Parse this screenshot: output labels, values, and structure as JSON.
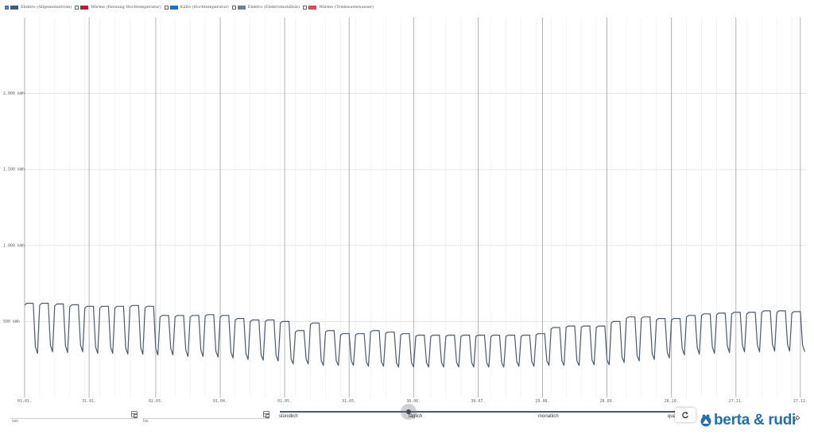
{
  "legend": [
    {
      "label": "Elektro (Allgemeinstrom)",
      "checked": true,
      "color": "#3d5a80"
    },
    {
      "label": "Wärme (Heizung Hochtemperatur)",
      "checked": false,
      "color": "#c0183a"
    },
    {
      "label": "Kälte (Hochtemperatur)",
      "checked": false,
      "color": "#1c73c4"
    },
    {
      "label": "Elektro (Elektromobilität)",
      "checked": false,
      "color": "#6a82a8"
    },
    {
      "label": "Wärme (Trinkwarmwasser)",
      "checked": false,
      "color": "#e0455f"
    }
  ],
  "controls": {
    "from_placeholder": "von",
    "to_placeholder": "bis",
    "resolution_options": [
      "stündlich",
      "täglich",
      "monatlich",
      "quartalsweise"
    ],
    "resolution_visible": [
      "stündlich",
      "täglich",
      "monatlich",
      "quar"
    ],
    "selected_resolution": "täglich"
  },
  "logo": {
    "text": "berta & rudi"
  },
  "chart_data": {
    "type": "line",
    "series": [
      {
        "name": "Elektro (Allgemeinstrom)",
        "color": "#4a5a70"
      }
    ],
    "ylabel_unit": "kWh",
    "yticks": [
      {
        "value": 500,
        "label": "500 kWh"
      },
      {
        "value": 1000,
        "label": "1.000 kWh"
      },
      {
        "value": 1500,
        "label": "1.500 kWh"
      },
      {
        "value": 2000,
        "label": "2.000 kWh"
      }
    ],
    "ylim": [
      0,
      2500
    ],
    "xlim_days": [
      0,
      364
    ],
    "xticks": [
      {
        "day": 0,
        "label": "01.01."
      },
      {
        "day": 30,
        "label": "31.01."
      },
      {
        "day": 61,
        "label": "02.03."
      },
      {
        "day": 91,
        "label": "01.04."
      },
      {
        "day": 121,
        "label": "01.05."
      },
      {
        "day": 151,
        "label": "31.05."
      },
      {
        "day": 181,
        "label": "30.06."
      },
      {
        "day": 211,
        "label": "30.07."
      },
      {
        "day": 241,
        "label": "29.08."
      },
      {
        "day": 271,
        "label": "28.09."
      },
      {
        "day": 301,
        "label": "28.10."
      },
      {
        "day": 331,
        "label": "27.11."
      },
      {
        "day": 361,
        "label": "27.12."
      }
    ],
    "weeks": [
      {
        "start_day": 0,
        "weekday": 620,
        "weekend": 290
      },
      {
        "start_day": 7,
        "weekday": 620,
        "weekend": 300
      },
      {
        "start_day": 14,
        "weekday": 615,
        "weekend": 295
      },
      {
        "start_day": 21,
        "weekday": 610,
        "weekend": 300
      },
      {
        "start_day": 28,
        "weekday": 600,
        "weekend": 290
      },
      {
        "start_day": 35,
        "weekday": 600,
        "weekend": 290
      },
      {
        "start_day": 42,
        "weekday": 600,
        "weekend": 285
      },
      {
        "start_day": 49,
        "weekday": 605,
        "weekend": 285
      },
      {
        "start_day": 56,
        "weekday": 600,
        "weekend": 280
      },
      {
        "start_day": 63,
        "weekday": 540,
        "weekend": 280
      },
      {
        "start_day": 70,
        "weekday": 540,
        "weekend": 270
      },
      {
        "start_day": 77,
        "weekday": 540,
        "weekend": 270
      },
      {
        "start_day": 84,
        "weekday": 545,
        "weekend": 265
      },
      {
        "start_day": 91,
        "weekday": 540,
        "weekend": 260
      },
      {
        "start_day": 98,
        "weekday": 520,
        "weekend": 250
      },
      {
        "start_day": 105,
        "weekday": 510,
        "weekend": 245
      },
      {
        "start_day": 112,
        "weekday": 510,
        "weekend": 240
      },
      {
        "start_day": 119,
        "weekday": 500,
        "weekend": 220
      },
      {
        "start_day": 126,
        "weekday": 440,
        "weekend": 220
      },
      {
        "start_day": 133,
        "weekday": 490,
        "weekend": 210
      },
      {
        "start_day": 140,
        "weekday": 440,
        "weekend": 210
      },
      {
        "start_day": 147,
        "weekday": 420,
        "weekend": 210
      },
      {
        "start_day": 154,
        "weekday": 420,
        "weekend": 205
      },
      {
        "start_day": 161,
        "weekday": 440,
        "weekend": 205
      },
      {
        "start_day": 168,
        "weekday": 430,
        "weekend": 200
      },
      {
        "start_day": 175,
        "weekday": 420,
        "weekend": 200
      },
      {
        "start_day": 182,
        "weekday": 410,
        "weekend": 200
      },
      {
        "start_day": 189,
        "weekday": 410,
        "weekend": 200
      },
      {
        "start_day": 196,
        "weekday": 410,
        "weekend": 200
      },
      {
        "start_day": 203,
        "weekday": 410,
        "weekend": 200
      },
      {
        "start_day": 210,
        "weekday": 410,
        "weekend": 200
      },
      {
        "start_day": 217,
        "weekday": 410,
        "weekend": 200
      },
      {
        "start_day": 224,
        "weekday": 410,
        "weekend": 205
      },
      {
        "start_day": 231,
        "weekday": 410,
        "weekend": 205
      },
      {
        "start_day": 238,
        "weekday": 420,
        "weekend": 210
      },
      {
        "start_day": 245,
        "weekday": 460,
        "weekend": 210
      },
      {
        "start_day": 252,
        "weekday": 470,
        "weekend": 210
      },
      {
        "start_day": 259,
        "weekday": 470,
        "weekend": 215
      },
      {
        "start_day": 266,
        "weekday": 470,
        "weekend": 215
      },
      {
        "start_day": 273,
        "weekday": 500,
        "weekend": 230
      },
      {
        "start_day": 280,
        "weekday": 530,
        "weekend": 240
      },
      {
        "start_day": 287,
        "weekday": 530,
        "weekend": 250
      },
      {
        "start_day": 294,
        "weekday": 520,
        "weekend": 260
      },
      {
        "start_day": 301,
        "weekday": 520,
        "weekend": 280
      },
      {
        "start_day": 308,
        "weekday": 540,
        "weekend": 285
      },
      {
        "start_day": 315,
        "weekday": 550,
        "weekend": 290
      },
      {
        "start_day": 322,
        "weekday": 555,
        "weekend": 295
      },
      {
        "start_day": 329,
        "weekday": 560,
        "weekend": 300
      },
      {
        "start_day": 336,
        "weekday": 560,
        "weekend": 300
      },
      {
        "start_day": 343,
        "weekday": 570,
        "weekend": 305
      },
      {
        "start_day": 350,
        "weekday": 570,
        "weekend": 305
      },
      {
        "start_day": 357,
        "weekday": 565,
        "weekend": 300
      }
    ]
  }
}
